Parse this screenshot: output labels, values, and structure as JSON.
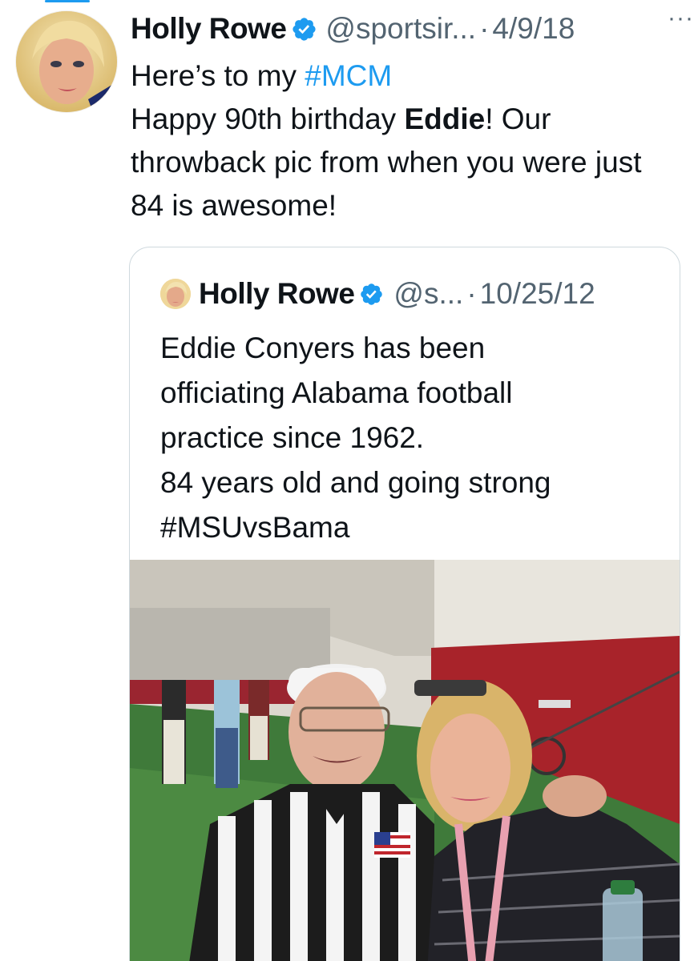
{
  "tweet": {
    "author": {
      "name": "Holly Rowe",
      "handle": "@sportsir...",
      "verified_icon": "verified-badge-icon"
    },
    "separator": "·",
    "date": "4/9/18",
    "more_icon": "more-options-icon",
    "more_glyph": "···",
    "text": {
      "line1_prefix": "Here’s to my ",
      "hashtag": "#MCM",
      "line2_prefix": "Happy 90th birthday ",
      "bold_name": "Eddie",
      "line2_suffix": "! Our throwback pic from when you were just 84 is awesome!"
    }
  },
  "quoted_tweet": {
    "author": {
      "name": "Holly Rowe",
      "handle": "@s...",
      "verified_icon": "verified-badge-icon"
    },
    "separator": "·",
    "date": "10/25/12",
    "lines": [
      "Eddie Conyers has been",
      "officiating Alabama football",
      "practice since 1962.",
      "84 years old and going strong",
      "#MSUvsBama"
    ],
    "photo_icon": "tweet-photo"
  },
  "colors": {
    "link_blue": "#1d9bf0",
    "secondary_text": "#536471",
    "primary_text": "#0f1419",
    "border": "#cfd9de"
  }
}
